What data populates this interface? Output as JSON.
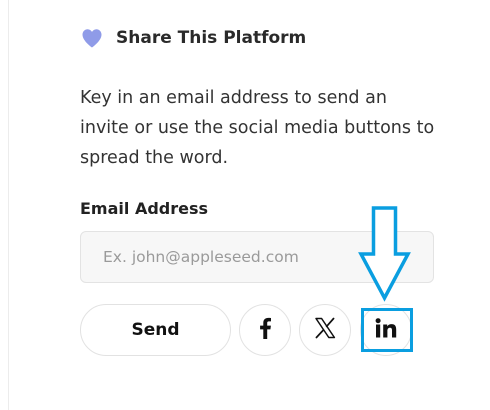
{
  "share": {
    "title": "Share This Platform",
    "description": "Key in an email address to send an invite or use the social media buttons to spread the word.",
    "email_label": "Email Address",
    "email_placeholder": "Ex. john@appleseed.com",
    "email_value": "",
    "send_label": "Send",
    "social_buttons": [
      {
        "name": "facebook",
        "icon": "facebook-icon"
      },
      {
        "name": "x",
        "icon": "x-icon"
      },
      {
        "name": "linkedin",
        "icon": "linkedin-icon"
      }
    ]
  },
  "annotation": {
    "target": "linkedin",
    "color": "#0a9ee0"
  },
  "colors": {
    "heart": "#8f9be8",
    "annotation": "#0a9ee0"
  }
}
